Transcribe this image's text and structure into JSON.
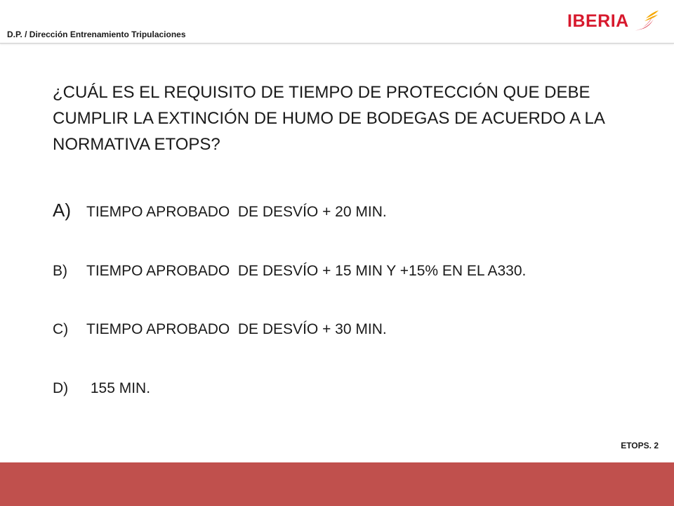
{
  "header": {
    "department": "D.P. / Dirección Entrenamiento Tripulaciones",
    "logo_text": "IBERIA"
  },
  "question": {
    "text": "¿CUÁL ES EL REQUISITO DE TIEMPO DE PROTECCIÓN QUE DEBE CUMPLIR LA EXTINCIÓN DE HUMO DE BODEGAS DE ACUERDO A LA NORMATIVA ETOPS?"
  },
  "answers": [
    {
      "letter": "A)",
      "text": "TIEMPO APROBADO  DE DESVÍO + 20 MIN."
    },
    {
      "letter": "B)",
      "text": "TIEMPO APROBADO  DE DESVÍO + 15 MIN Y +15% EN EL A330."
    },
    {
      "letter": "C)",
      "text": "TIEMPO APROBADO  DE DESVÍO + 30 MIN."
    },
    {
      "letter": "D)",
      "text": " 155 MIN."
    }
  ],
  "footer": {
    "page_label": "ETOPS. 2",
    "band_color": "#c0504d"
  },
  "colors": {
    "brand_red": "#d7192d",
    "brand_yellow": "#f6a800"
  }
}
